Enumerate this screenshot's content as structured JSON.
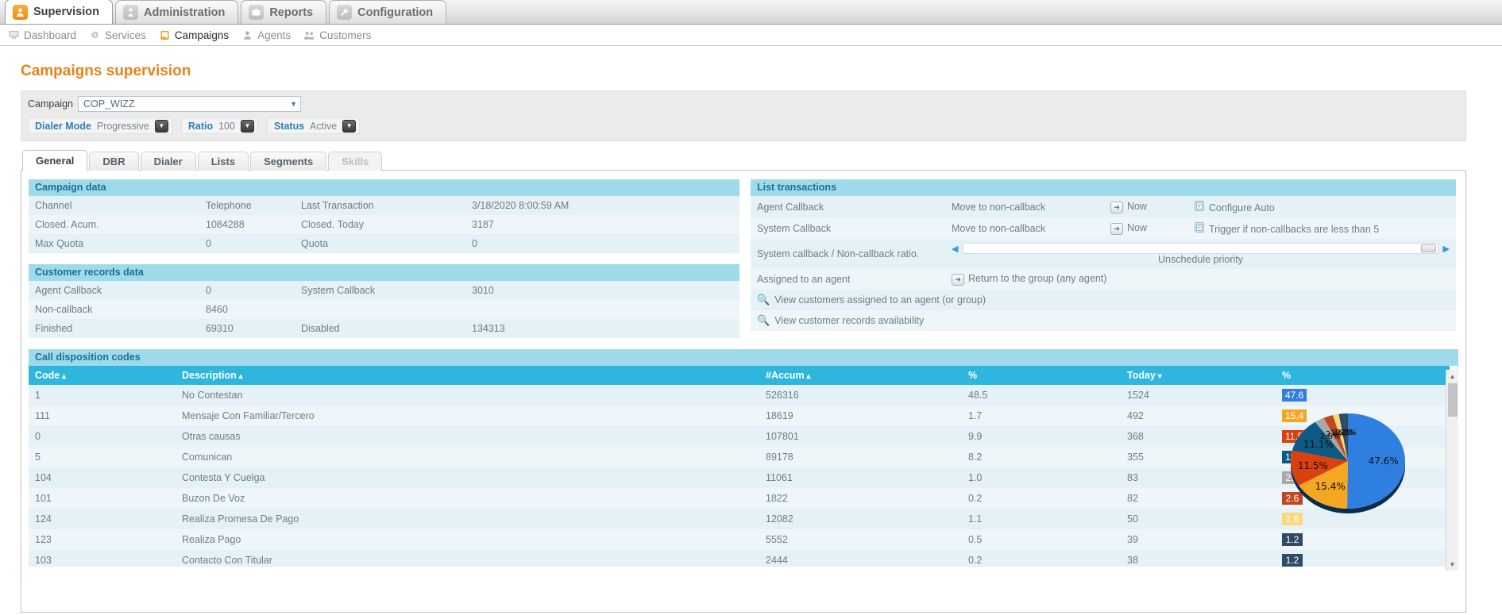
{
  "topnav": [
    {
      "label": "Supervision",
      "icon": "user-icon",
      "active": true
    },
    {
      "label": "Administration",
      "icon": "pawn-icon",
      "active": false
    },
    {
      "label": "Reports",
      "icon": "briefcase-icon",
      "active": false
    },
    {
      "label": "Configuration",
      "icon": "wrench-icon",
      "active": false
    }
  ],
  "subnav": [
    {
      "label": "Dashboard",
      "icon": "monitor-icon",
      "active": false
    },
    {
      "label": "Services",
      "icon": "gear-icon",
      "active": false
    },
    {
      "label": "Campaigns",
      "icon": "campaign-icon",
      "active": true
    },
    {
      "label": "Agents",
      "icon": "agent-icon",
      "active": false
    },
    {
      "label": "Customers",
      "icon": "customers-icon",
      "active": false
    }
  ],
  "page": {
    "title": "Campaigns supervision"
  },
  "selector": {
    "campaign_label": "Campaign",
    "campaign_value": "COP_WIZZ",
    "dialer_mode_label": "Dialer Mode",
    "dialer_mode_value": "Progressive",
    "ratio_label": "Ratio",
    "ratio_value": "100",
    "status_label": "Status",
    "status_value": "Active"
  },
  "subtabs": [
    {
      "label": "General",
      "active": true,
      "disabled": false
    },
    {
      "label": "DBR",
      "active": false,
      "disabled": false
    },
    {
      "label": "Dialer",
      "active": false,
      "disabled": false
    },
    {
      "label": "Lists",
      "active": false,
      "disabled": false
    },
    {
      "label": "Segments",
      "active": false,
      "disabled": false
    },
    {
      "label": "Skills",
      "active": false,
      "disabled": true
    }
  ],
  "campaign_data": {
    "title": "Campaign data",
    "rows": [
      {
        "k1": "Channel",
        "v1": "Telephone",
        "k2": "Last Transaction",
        "v2": "3/18/2020 8:00:59 AM"
      },
      {
        "k1": "Closed. Acum.",
        "v1": "1084288",
        "k2": "Closed. Today",
        "v2": "3187"
      },
      {
        "k1": "Max Quota",
        "v1": "0",
        "k2": "Quota",
        "v2": "0"
      }
    ]
  },
  "customer_records_data": {
    "title": "Customer records data",
    "rows": [
      {
        "k1": "Agent Callback",
        "v1": "0",
        "k2": "System Callback",
        "v2": "3010"
      },
      {
        "k1": "Non-callback",
        "v1": "8460",
        "k2": "",
        "v2": ""
      },
      {
        "k1": "Finished",
        "v1": "69310",
        "k2": "Disabled",
        "v2": "134313"
      }
    ]
  },
  "list_transactions": {
    "title": "List transactions",
    "rows": [
      {
        "name": "Agent Callback",
        "action": "Move to non-callback",
        "now": "Now",
        "extra": "Configure Auto"
      },
      {
        "name": "System Callback",
        "action": "Move to non-callback",
        "now": "Now",
        "extra": "Trigger if non-callbacks are less than 5"
      }
    ],
    "ratio_label": "System callback / Non-callback ratio.",
    "unschedule_label": "Unschedule priority",
    "assigned_label": "Assigned to an agent",
    "assigned_action": "Return to the group (any agent)",
    "links": [
      "View customers assigned to an agent (or group)",
      "View customer records availability"
    ]
  },
  "disposition": {
    "title": "Call disposition codes",
    "columns": [
      "Code",
      "Description",
      "#Accum",
      "%",
      "Today",
      "%"
    ],
    "sort": [
      "asc",
      "asc",
      "asc",
      "",
      "desc",
      ""
    ],
    "rows": [
      {
        "code": "1",
        "desc": "No Contestan",
        "accum": "526316",
        "pct": "48.5",
        "today": "1524",
        "today_pct": "47.6",
        "chip": "#2f7fe0"
      },
      {
        "code": "111",
        "desc": "Mensaje Con Familiar/Tercero",
        "accum": "18619",
        "pct": "1.7",
        "today": "492",
        "today_pct": "15.4",
        "chip": "#f5a623"
      },
      {
        "code": "0",
        "desc": "Otras causas",
        "accum": "107801",
        "pct": "9.9",
        "today": "368",
        "today_pct": "11.5",
        "chip": "#d9410f"
      },
      {
        "code": "5",
        "desc": "Comunican",
        "accum": "89178",
        "pct": "8.2",
        "today": "355",
        "today_pct": "11.1",
        "chip": "#0d5a84"
      },
      {
        "code": "104",
        "desc": "Contesta Y Cuelga",
        "accum": "11061",
        "pct": "1.0",
        "today": "83",
        "today_pct": "2.6",
        "chip": "#a8a8a8"
      },
      {
        "code": "101",
        "desc": "Buzon De Voz",
        "accum": "1822",
        "pct": "0.2",
        "today": "82",
        "today_pct": "2.6",
        "chip": "#c0471f"
      },
      {
        "code": "124",
        "desc": "Realiza Promesa De Pago",
        "accum": "12082",
        "pct": "1.1",
        "today": "50",
        "today_pct": "1.6",
        "chip": "#fbd97a"
      },
      {
        "code": "123",
        "desc": "Realiza Pago",
        "accum": "5552",
        "pct": "0.5",
        "today": "39",
        "today_pct": "1.2",
        "chip": "#2f4a66"
      },
      {
        "code": "103",
        "desc": "Contacto Con Titular",
        "accum": "2444",
        "pct": "0.2",
        "today": "38",
        "today_pct": "1.2",
        "chip": "#2f4a66"
      }
    ]
  },
  "chart_data": {
    "type": "pie",
    "title": "",
    "labels": [
      "No Contestan",
      "Mensaje Con Familiar/Tercero",
      "Otras causas",
      "Comunican",
      "Contesta Y Cuelga",
      "Buzon De Voz",
      "Realiza Promesa De Pago",
      "Realiza Pago",
      "Contacto Con Titular"
    ],
    "values": [
      47.6,
      15.4,
      11.5,
      11.1,
      2.6,
      2.6,
      1.6,
      1.2,
      1.2
    ],
    "data_labels": [
      "47.6%",
      "15.4%",
      "11.5%",
      "11.1%",
      "2.6%",
      "2.6%",
      "1.6%",
      "1.2%",
      "1.2%"
    ],
    "colors": [
      "#2f7fe0",
      "#f5a623",
      "#d9410f",
      "#0d5a84",
      "#a8a8a8",
      "#c0471f",
      "#fbd97a",
      "#2f4a66",
      "#2f4a66"
    ],
    "legend": "none"
  }
}
